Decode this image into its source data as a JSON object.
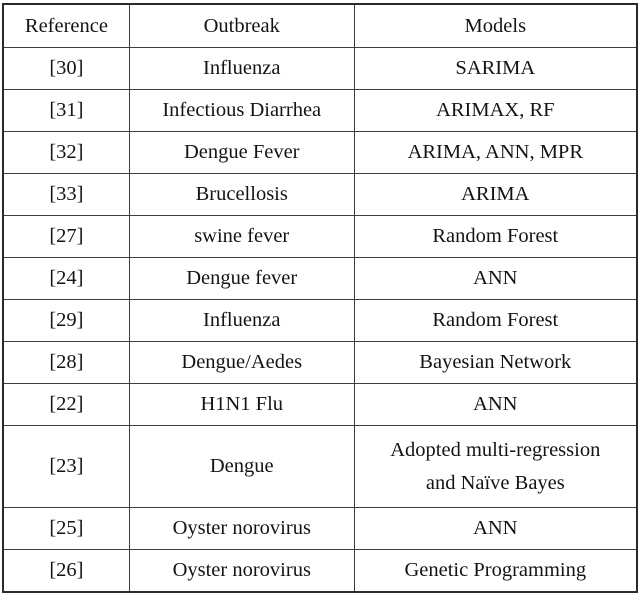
{
  "table": {
    "caption": "",
    "columns": [
      {
        "key": "reference",
        "label": "Reference"
      },
      {
        "key": "outbreak",
        "label": "Outbreak"
      },
      {
        "key": "models",
        "label": "Models"
      }
    ],
    "rows": [
      {
        "reference": "[30]",
        "outbreak": "Influenza",
        "models": "SARIMA"
      },
      {
        "reference": "[31]",
        "outbreak": "Infectious Diarrhea",
        "models": "ARIMAX, RF"
      },
      {
        "reference": "[32]",
        "outbreak": "Dengue Fever",
        "models": "ARIMA, ANN, MPR"
      },
      {
        "reference": "[33]",
        "outbreak": "Brucellosis",
        "models": "ARIMA"
      },
      {
        "reference": "[27]",
        "outbreak": "swine fever",
        "models": "Random Forest"
      },
      {
        "reference": "[24]",
        "outbreak": "Dengue fever",
        "models": "ANN"
      },
      {
        "reference": "[29]",
        "outbreak": "Influenza",
        "models": "Random Forest"
      },
      {
        "reference": "[28]",
        "outbreak": "Dengue/Aedes",
        "models": "Bayesian Network"
      },
      {
        "reference": "[22]",
        "outbreak": "H1N1 Flu",
        "models": "ANN"
      },
      {
        "reference": "[23]",
        "outbreak": "Dengue",
        "models": "Adopted multi-regression and Naïve Bayes",
        "models_lines": [
          "Adopted multi-regression",
          "and Naïve Bayes"
        ],
        "tall": true
      },
      {
        "reference": "[25]",
        "outbreak": "Oyster norovirus",
        "models": "ANN"
      },
      {
        "reference": "[26]",
        "outbreak": "Oyster norovirus",
        "models": "Genetic Programming"
      }
    ]
  },
  "style": {
    "border_color": "#3d3d3d",
    "outer_border_color": "#2b2b2b",
    "text_color": "#141414",
    "background_color": "#ffffff"
  }
}
